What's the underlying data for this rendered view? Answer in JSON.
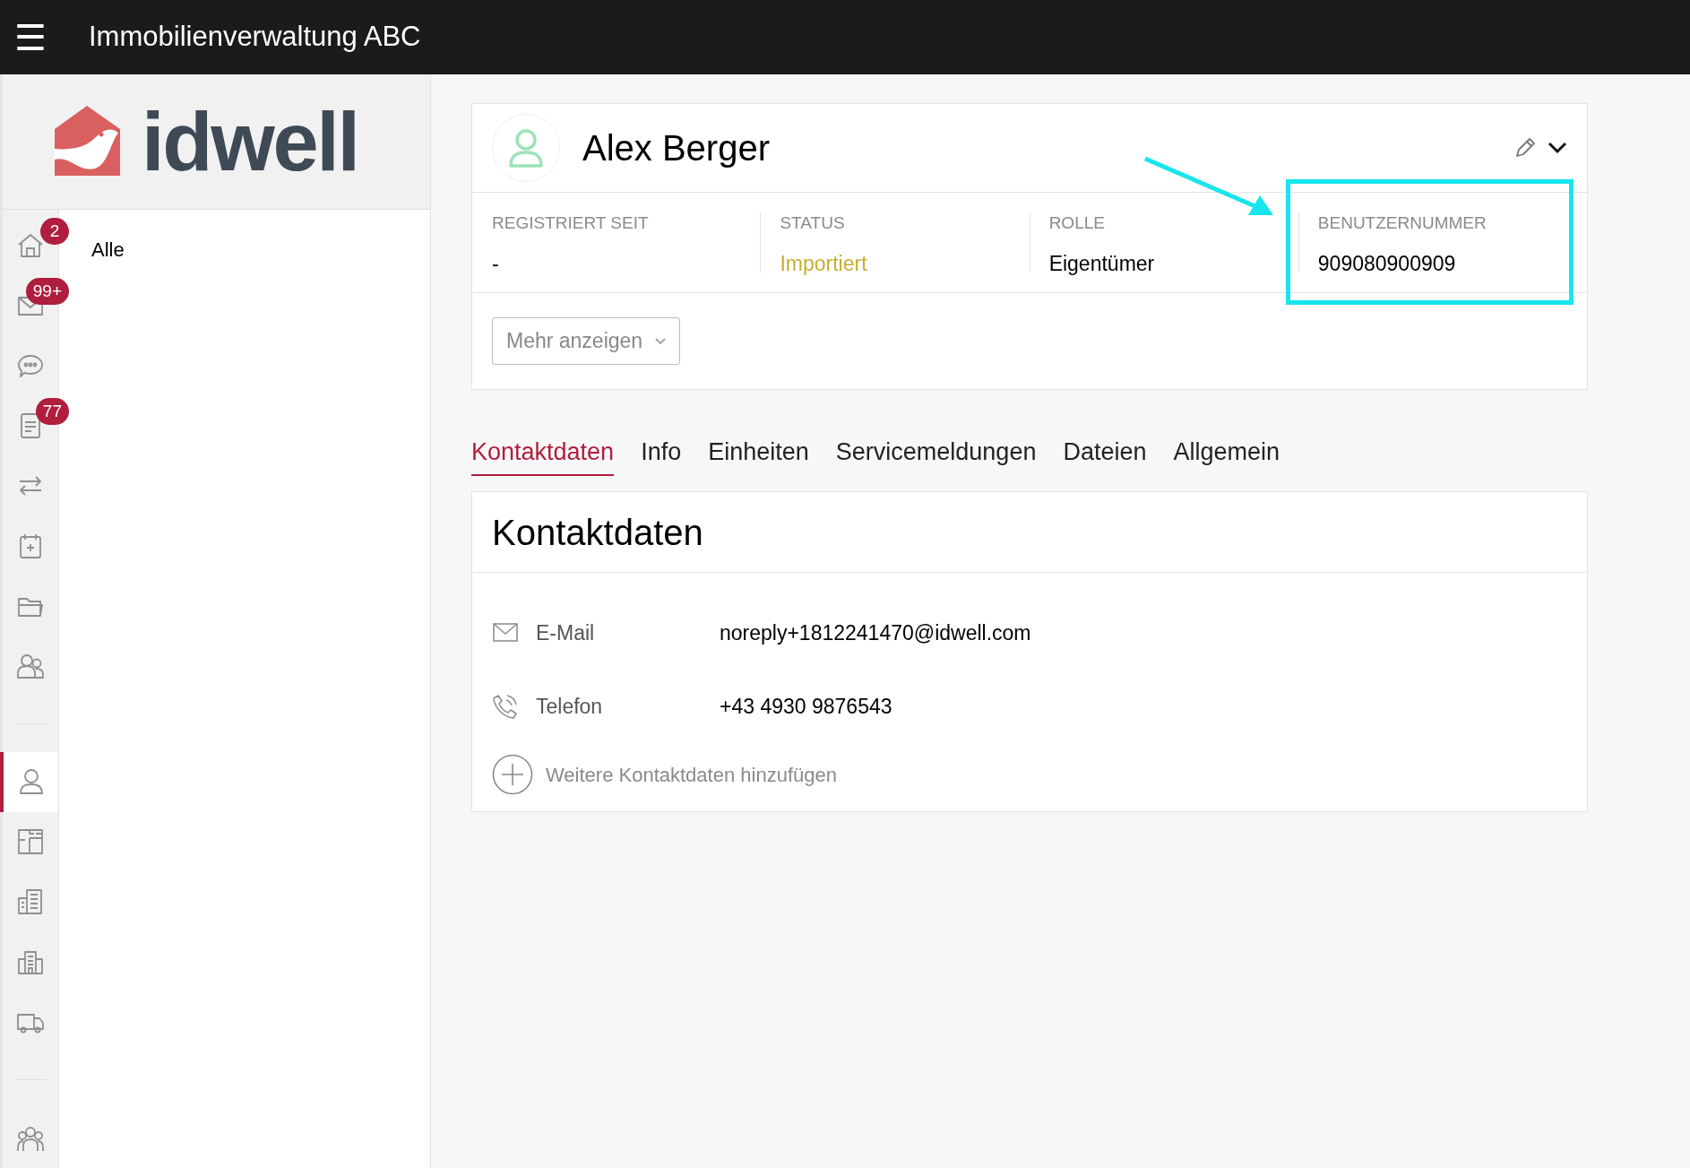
{
  "app_bar": {
    "menu_icon": "☰",
    "title": "Immobilienverwaltung ABC"
  },
  "logo": {
    "text": "idwell"
  },
  "sidebar": {
    "items": [
      {
        "kind": "home",
        "badge": "2",
        "selected": false
      },
      {
        "kind": "mail",
        "badge": "99+",
        "selected": false
      },
      {
        "kind": "chat",
        "selected": false
      },
      {
        "kind": "document",
        "badge": "77",
        "selected": false
      },
      {
        "kind": "transfer",
        "selected": false
      },
      {
        "kind": "calendar",
        "selected": false
      },
      {
        "kind": "folder",
        "selected": false
      },
      {
        "kind": "users",
        "selected": false
      },
      {
        "kind": "divider"
      },
      {
        "kind": "person",
        "selected": true
      },
      {
        "kind": "floorplan",
        "selected": false
      },
      {
        "kind": "building",
        "selected": false
      },
      {
        "kind": "buildings",
        "selected": false
      },
      {
        "kind": "truck",
        "selected": false
      },
      {
        "kind": "divider"
      },
      {
        "kind": "group",
        "selected": false
      }
    ]
  },
  "filter_panel": {
    "items": [
      "Alle"
    ]
  },
  "profile": {
    "name": "Alex Berger",
    "fields": [
      {
        "label": "REGISTRIERT SEIT",
        "value": "-",
        "kind": "plain"
      },
      {
        "label": "STATUS",
        "value": "Importiert",
        "kind": "status"
      },
      {
        "label": "ROLLE",
        "value": "Eigentümer",
        "kind": "plain"
      },
      {
        "label": "BENUTZERNUMMER",
        "value": "909080900909",
        "kind": "plain",
        "highlighted": true
      }
    ],
    "more_button": "Mehr anzeigen"
  },
  "tabs": [
    {
      "label": "Kontaktdaten",
      "selected": true
    },
    {
      "label": "Info",
      "selected": false
    },
    {
      "label": "Einheiten",
      "selected": false
    },
    {
      "label": "Servicemeldungen",
      "selected": false
    },
    {
      "label": "Dateien",
      "selected": false
    },
    {
      "label": "Allgemein",
      "selected": false
    }
  ],
  "contact": {
    "title": "Kontaktdaten",
    "rows": [
      {
        "kind": "email",
        "label": "E-Mail",
        "value": "noreply+1812241470@idwell.com"
      },
      {
        "kind": "phone",
        "label": "Telefon",
        "value": "+43 4930 9876543"
      }
    ],
    "add_link": "Weitere Kontaktdaten hinzufügen"
  }
}
